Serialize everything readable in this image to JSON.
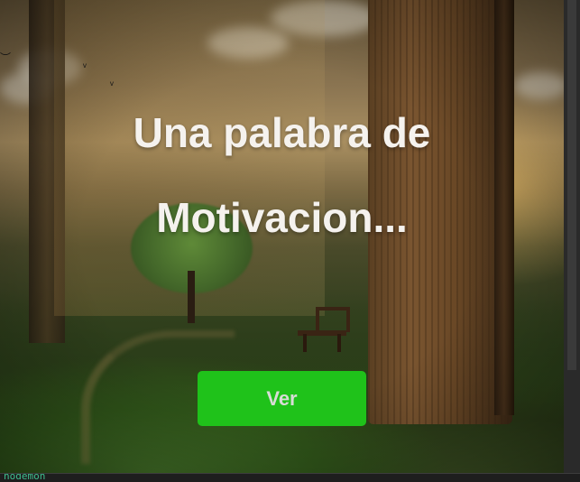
{
  "hero": {
    "title_line1": "Una palabra de",
    "title_line2": "Motivacion...",
    "button_label": "Ver"
  },
  "terminal": {
    "text": "nodemon"
  },
  "colors": {
    "button_bg": "#1fc21a",
    "button_text": "#d8dcd6",
    "title_text": "#f5f2ee",
    "terminal_text": "#3fbf8f"
  }
}
